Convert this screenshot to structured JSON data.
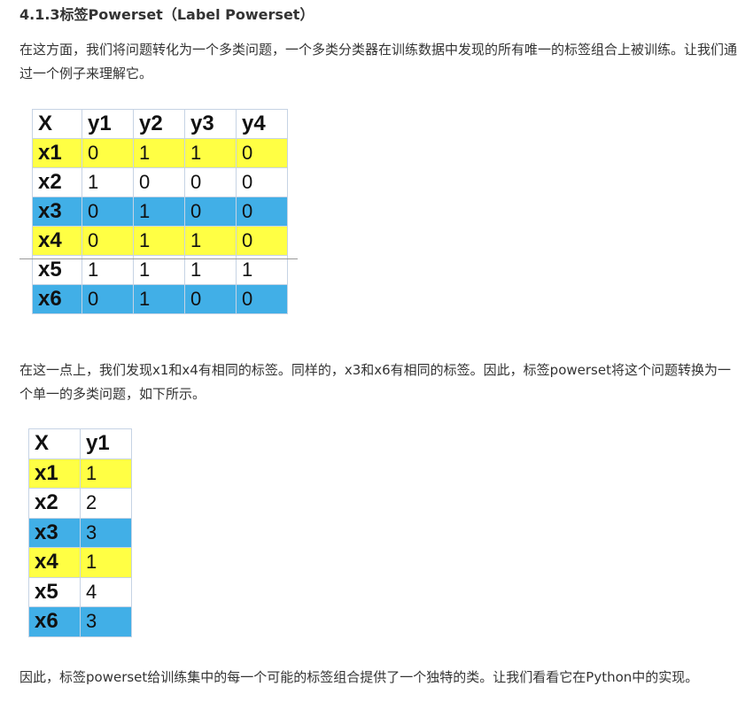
{
  "heading": "4.1.3标签Powerset（Label Powerset）",
  "paragraph1": "在这方面，我们将问题转化为一个多类问题，一个多类分类器在训练数据中发现的所有唯一的标签组合上被训练。让我们通过一个例子来理解它。",
  "table1": {
    "headers": [
      "X",
      "y1",
      "y2",
      "y3",
      "y4"
    ],
    "rows": [
      {
        "color": "yellow",
        "cells": [
          "x1",
          "0",
          "1",
          "1",
          "0"
        ]
      },
      {
        "color": "white",
        "cells": [
          "x2",
          "1",
          "0",
          "0",
          "0"
        ]
      },
      {
        "color": "blue",
        "cells": [
          "x3",
          "0",
          "1",
          "0",
          "0"
        ]
      },
      {
        "color": "yellow",
        "cells": [
          "x4",
          "0",
          "1",
          "1",
          "0"
        ]
      },
      {
        "color": "white",
        "cells": [
          "x5",
          "1",
          "1",
          "1",
          "1"
        ]
      },
      {
        "color": "blue",
        "cells": [
          "x6",
          "0",
          "1",
          "0",
          "0"
        ]
      }
    ]
  },
  "paragraph2": "在这一点上，我们发现x1和x4有相同的标签。同样的，x3和x6有相同的标签。因此，标签powerset将这个问题转换为一个单一的多类问题，如下所示。",
  "table2": {
    "headers": [
      "X",
      "y1"
    ],
    "rows": [
      {
        "color": "yellow",
        "cells": [
          "x1",
          "1"
        ]
      },
      {
        "color": "white",
        "cells": [
          "x2",
          "2"
        ]
      },
      {
        "color": "blue",
        "cells": [
          "x3",
          "3"
        ]
      },
      {
        "color": "yellow",
        "cells": [
          "x4",
          "1"
        ]
      },
      {
        "color": "white",
        "cells": [
          "x5",
          "4"
        ]
      },
      {
        "color": "blue",
        "cells": [
          "x6",
          "3"
        ]
      }
    ]
  },
  "paragraph3": "因此，标签powerset给训练集中的每一个可能的标签组合提供了一个独特的类。让我们看看它在Python中的实现。",
  "colors": {
    "yellow": "#ffff44",
    "blue": "#41afe7",
    "white": "#ffffff",
    "text": "#333333"
  }
}
